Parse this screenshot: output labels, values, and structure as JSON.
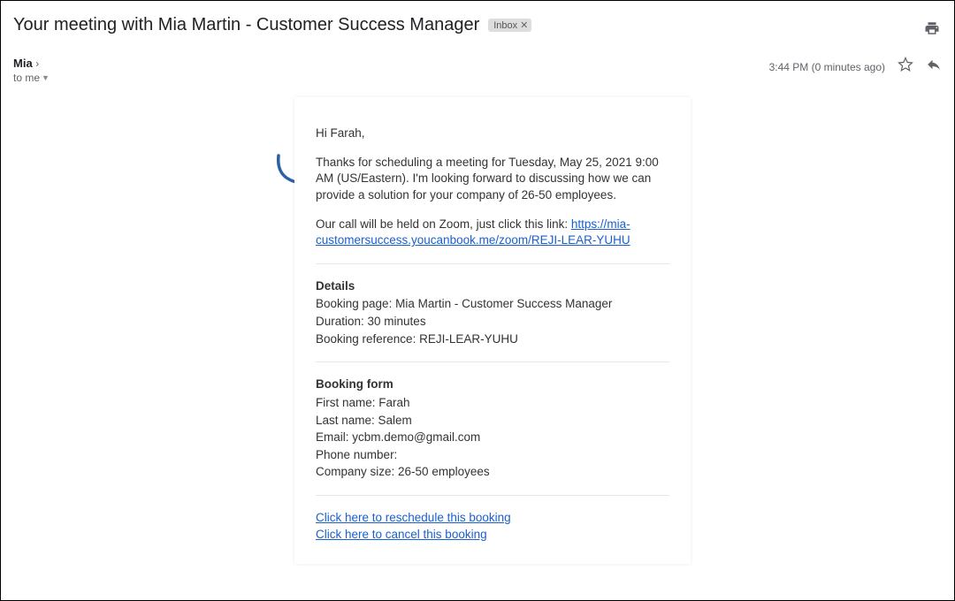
{
  "header": {
    "subject": "Your meeting with Mia Martin - Customer Success Manager",
    "chip_label": "Inbox"
  },
  "meta": {
    "sender_name": "Mia",
    "sender_extra": "›",
    "to_line": "to me",
    "timestamp": "3:44 PM (0 minutes ago)"
  },
  "email": {
    "greeting": "Hi Farah,",
    "intro": "Thanks for scheduling a meeting for Tuesday, May 25, 2021 9:00 AM (US/Eastern). I'm looking forward to discussing how we can provide a solution for your company of 26-50 employees.",
    "zoom_prefix": "Our call will be held on Zoom, just click this link: ",
    "zoom_link": "https://mia-customersuccess.youcanbook.me/zoom/REJI-LEAR-YUHU",
    "details_heading": "Details",
    "details": {
      "booking_page": "Booking page: Mia Martin - Customer Success Manager",
      "duration": "Duration: 30 minutes",
      "reference": "Booking reference: REJI-LEAR-YUHU"
    },
    "form_heading": "Booking form",
    "form": {
      "first": "First name: Farah",
      "last": "Last name: Salem",
      "email": "Email: ycbm.demo@gmail.com",
      "phone": "Phone number:",
      "company": "Company size: 26-50 employees"
    },
    "links": {
      "reschedule": "Click here to reschedule this booking",
      "cancel": "Click here to cancel this booking"
    }
  }
}
